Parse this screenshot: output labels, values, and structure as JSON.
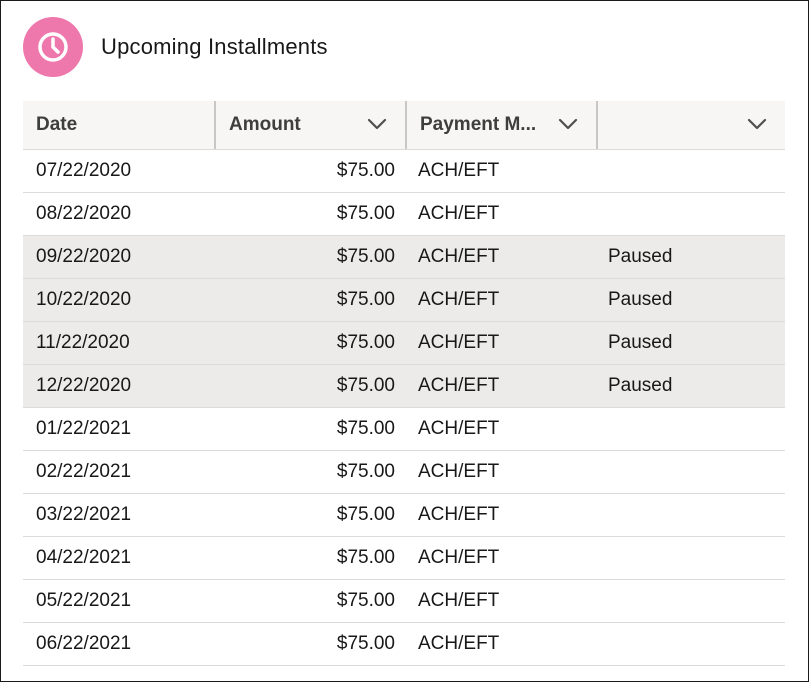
{
  "header": {
    "title": "Upcoming Installments",
    "icon": "clock-icon",
    "icon_bg_color": "#ee78ac"
  },
  "table": {
    "columns": [
      {
        "label": "Date",
        "has_menu": false
      },
      {
        "label": "Amount",
        "has_menu": true
      },
      {
        "label": "Payment M...",
        "has_menu": true
      },
      {
        "label": "",
        "has_menu": true
      }
    ],
    "rows": [
      {
        "date": "07/22/2020",
        "amount": "$75.00",
        "method": "ACH/EFT",
        "status": ""
      },
      {
        "date": "08/22/2020",
        "amount": "$75.00",
        "method": "ACH/EFT",
        "status": ""
      },
      {
        "date": "09/22/2020",
        "amount": "$75.00",
        "method": "ACH/EFT",
        "status": "Paused"
      },
      {
        "date": "10/22/2020",
        "amount": "$75.00",
        "method": "ACH/EFT",
        "status": "Paused"
      },
      {
        "date": "11/22/2020",
        "amount": "$75.00",
        "method": "ACH/EFT",
        "status": "Paused"
      },
      {
        "date": "12/22/2020",
        "amount": "$75.00",
        "method": "ACH/EFT",
        "status": "Paused"
      },
      {
        "date": "01/22/2021",
        "amount": "$75.00",
        "method": "ACH/EFT",
        "status": ""
      },
      {
        "date": "02/22/2021",
        "amount": "$75.00",
        "method": "ACH/EFT",
        "status": ""
      },
      {
        "date": "03/22/2021",
        "amount": "$75.00",
        "method": "ACH/EFT",
        "status": ""
      },
      {
        "date": "04/22/2021",
        "amount": "$75.00",
        "method": "ACH/EFT",
        "status": ""
      },
      {
        "date": "05/22/2021",
        "amount": "$75.00",
        "method": "ACH/EFT",
        "status": ""
      },
      {
        "date": "06/22/2021",
        "amount": "$75.00",
        "method": "ACH/EFT",
        "status": ""
      }
    ],
    "paused_row_color": "#ecebea"
  }
}
